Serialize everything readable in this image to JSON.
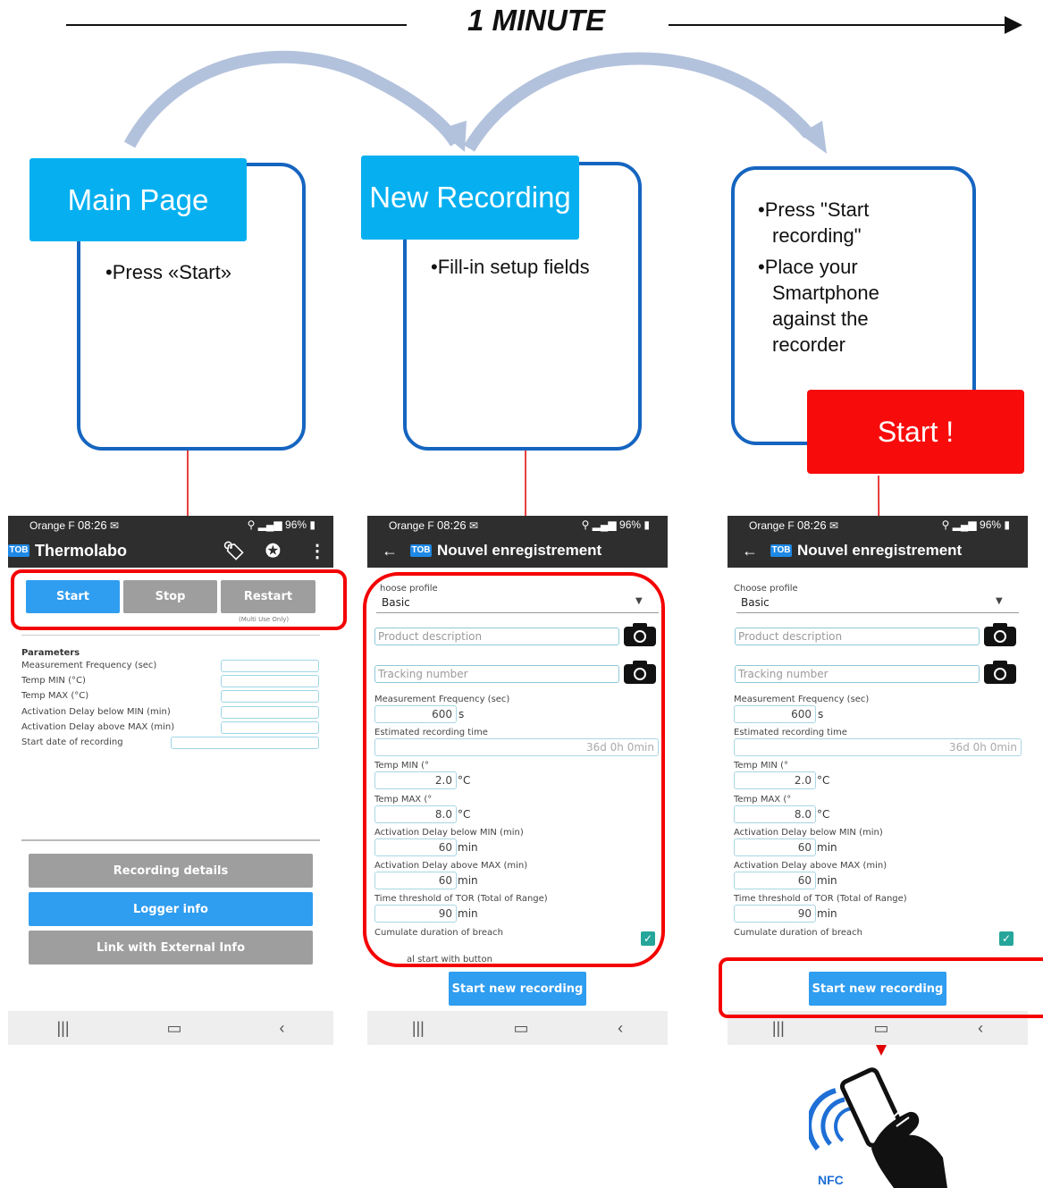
{
  "title": "1 MINUTE",
  "steps": [
    {
      "header": "Main Page",
      "bullets": [
        "•Press «Start»"
      ]
    },
    {
      "header": "New Recording",
      "bullets": [
        "•Fill-in setup fields"
      ]
    },
    {
      "header": "",
      "bullets": [
        "•Press \"Start recording\"",
        "•Place your Smartphone against the recorder"
      ]
    }
  ],
  "start_label": "Start !",
  "status": {
    "carrier": "Orange F",
    "time": "08:26",
    "battery": "96%"
  },
  "phone1": {
    "app_title": "Thermolabo",
    "buttons": {
      "start": "Start",
      "stop": "Stop",
      "restart": "Restart",
      "restart_note": "(Multi Use Only)"
    },
    "params_title": "Parameters",
    "params": [
      "Measurement Frequency (sec)",
      "Temp MIN (°C)",
      "Temp MAX (°C)",
      "Activation Delay below MIN (min)",
      "Activation Delay above MAX (min)",
      "Start date of recording"
    ],
    "bottom_buttons": [
      "Recording details",
      "Logger info",
      "Link with External Info"
    ]
  },
  "phone2": {
    "title": "Nouvel enregistrement",
    "profile_label": "hoose profile",
    "profile_value": "Basic",
    "product_placeholder": "Product description",
    "tracking_placeholder": "Tracking number",
    "freq_label": "Measurement Frequency (sec)",
    "freq_value": "600",
    "freq_unit": "s",
    "est_label": "Estimated recording time",
    "est_value": "36d 0h 0min",
    "tmin_label": "Temp MIN (°",
    "tmin_value": "2.0",
    "tmax_label": "Temp MAX (°",
    "tmax_value": "8.0",
    "temp_unit": "°C",
    "below_label": "Activation Delay below MIN (min)",
    "below_value": "60",
    "above_label": "Activation Delay above MAX (min)",
    "above_value": "60",
    "tor_label": "Time threshold of TOR (Total of Range)",
    "tor_value": "90",
    "min_unit": "min",
    "cumulate_label": "Cumulate duration of breach",
    "manual_label": "al start with button",
    "start_button": "Start new recording"
  },
  "phone3": {
    "title": "Nouvel enregistrement",
    "profile_label": "Choose profile",
    "profile_value": "Basic",
    "product_placeholder": "Product description",
    "tracking_placeholder": "Tracking number",
    "freq_label": "Measurement Frequency (sec)",
    "freq_value": "600",
    "freq_unit": "s",
    "est_label": "Estimated recording time",
    "est_value": "36d 0h 0min",
    "tmin_label": "Temp MIN (°",
    "tmin_value": "2.0",
    "tmax_label": "Temp MAX (°",
    "tmax_value": "8.0",
    "temp_unit": "°C",
    "below_label": "Activation Delay below MIN (min)",
    "below_value": "60",
    "above_label": "Activation Delay above MAX (min)",
    "above_value": "60",
    "tor_label": "Time threshold of TOR (Total of Range)",
    "tor_value": "90",
    "min_unit": "min",
    "cumulate_label": "Cumulate duration of breach",
    "start_button": "Start new recording"
  },
  "nfc_label": "NFC",
  "colors": {
    "header_blue": "#06b0f0",
    "frame_blue": "#1565c0",
    "highlight_red": "#f40000",
    "start_red": "#f80b0b",
    "arc": "#b3c2dc"
  }
}
